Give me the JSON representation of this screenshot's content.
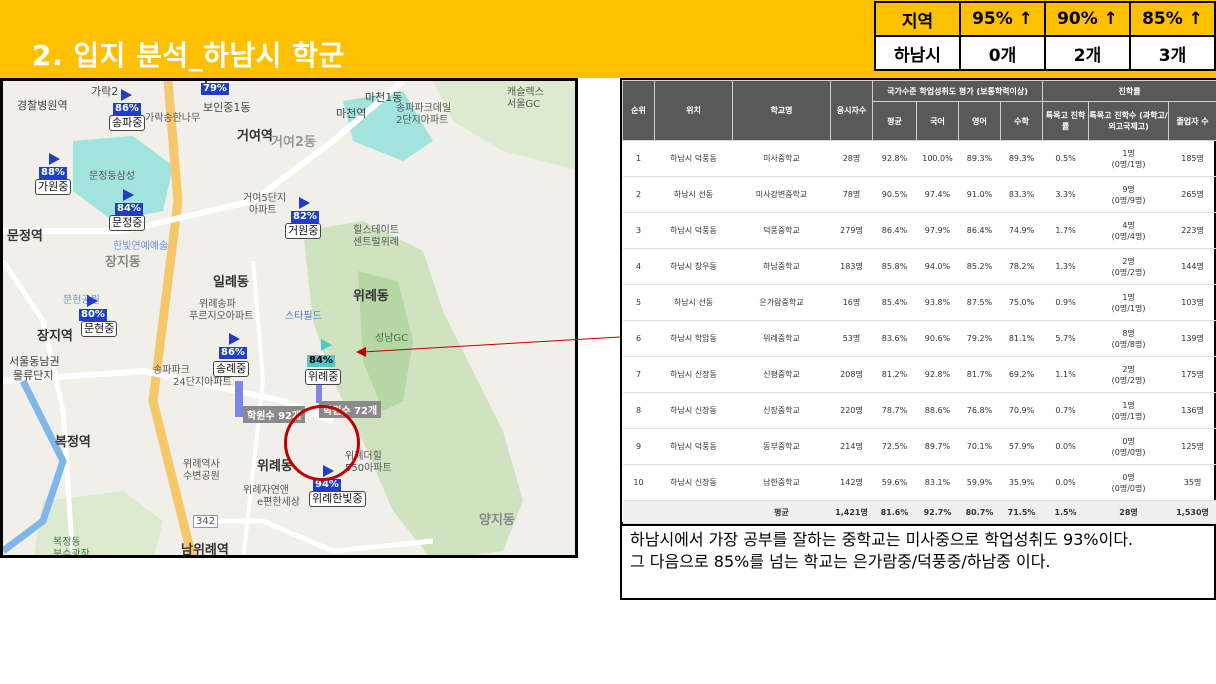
{
  "title": "2. 입지 분석_하남시 학군",
  "summary": {
    "headers": [
      "지역",
      "95% ↑",
      "90% ↑",
      "85% ↑"
    ],
    "row": [
      "하남시",
      "0개",
      "2개",
      "3개"
    ]
  },
  "map": {
    "labels": {
      "garak": "가락2",
      "gyeongchal": "경찰병원역",
      "songpa_apt": "가락송한나무",
      "boinjung": "보인중1동",
      "madang": "마천1동",
      "macheon": "마천역",
      "songpapark": "송파파크데일",
      "park2": "2단지아파트",
      "golf": "캐슬렉스",
      "seoulgc": "서울GC",
      "georyeo": "거여역",
      "georyeo2": "거여2동",
      "munjeong_saem": "문정동삼성",
      "munjeong": "문정역",
      "georyeo5": "거여5단지",
      "apt": "아파트",
      "hill": "힐스테이트",
      "central": "센트럴위례",
      "hanbit": "한빛연예예술",
      "jangji": "장지동",
      "irye": "일례동",
      "wirye_dong": "위례동",
      "wirye_songpa": "위례송파",
      "pureuji": "푸르지오아파트",
      "starfield": "스타필드",
      "seongnam": "성남GC",
      "munhyeon_park": "문현공원",
      "jangji_yeok": "장지역",
      "seouldong": "서울동남권",
      "mulryu": "물류단지",
      "songpa_24": "송파파크",
      "danji24": "24단지아파트",
      "wirye_ele": "위례역사",
      "subyeon": "수변공원",
      "wirye_dong2": "위례동",
      "wiryejayeon": "위례자연앤",
      "pyeonhan": "e편한세상",
      "wiryedel": "위례더힐",
      "apt550": "550아파트",
      "bokjeong": "복정역",
      "yangji": "양지동",
      "namwirye": "남위례역",
      "bokjeong_park": "복정동",
      "bunsugwangjang": "분수광장",
      "road342": "342"
    },
    "markers": [
      {
        "pct": "79%",
        "school": ""
      },
      {
        "pct": "86%",
        "school": "송파중"
      },
      {
        "pct": "88%",
        "school": "가원중"
      },
      {
        "pct": "84%",
        "school": "문정중"
      },
      {
        "pct": "82%",
        "school": "거원중"
      },
      {
        "pct": "80%",
        "school": "문현중"
      },
      {
        "pct": "86%",
        "school": "송례중"
      },
      {
        "pct": "84%",
        "school": "위례중"
      },
      {
        "pct": "94%",
        "school": "위례한빛중"
      }
    ],
    "tags": [
      "학원수 92개",
      "학원수 72개"
    ]
  },
  "table": {
    "group_headers": {
      "score": "국가수준 학업성취도 평가 (보통학력이상)",
      "advance": "진학률"
    },
    "headers": [
      "순위",
      "위치",
      "학교명",
      "응시자수",
      "평균",
      "국어",
      "영어",
      "수학",
      "특목고 진학률",
      "특목고 진학수 (과학고/외고국제고)",
      "졸업자 수"
    ],
    "rows": [
      [
        "1",
        "하남시 덕풍동",
        "미사중학교",
        "28명",
        "92.8%",
        "100.0%",
        "89.3%",
        "89.3%",
        "0.5%",
        "1명",
        "(0명/1명)",
        "185명"
      ],
      [
        "2",
        "하남시 선동",
        "미사강변중학교",
        "78명",
        "90.5%",
        "97.4%",
        "91.0%",
        "83.3%",
        "3.3%",
        "9명",
        "(0명/9명)",
        "265명"
      ],
      [
        "3",
        "하남시 덕풍동",
        "덕풍중학교",
        "279명",
        "86.4%",
        "97.9%",
        "86.4%",
        "74.9%",
        "1.7%",
        "4명",
        "(0명/4명)",
        "223명"
      ],
      [
        "4",
        "하남시 창우동",
        "하남중학교",
        "183명",
        "85.8%",
        "94.0%",
        "85.2%",
        "78.2%",
        "1.3%",
        "2명",
        "(0명/2명)",
        "144명"
      ],
      [
        "5",
        "하남시 선동",
        "은가람중학교",
        "16명",
        "85.4%",
        "93.8%",
        "87.5%",
        "75.0%",
        "0.9%",
        "1명",
        "(0명/1명)",
        "103명"
      ],
      [
        "6",
        "하남시 학암동",
        "위례중학교",
        "53명",
        "83.6%",
        "90.6%",
        "79.2%",
        "81.1%",
        "5.7%",
        "8명",
        "(0명/8명)",
        "139명"
      ],
      [
        "7",
        "하남시 신장동",
        "신평중학교",
        "208명",
        "81.2%",
        "92.8%",
        "81.7%",
        "69.2%",
        "1.1%",
        "2명",
        "(0명/2명)",
        "175명"
      ],
      [
        "8",
        "하남시 신장동",
        "신장중학교",
        "220명",
        "78.7%",
        "88.6%",
        "76.8%",
        "70.9%",
        "0.7%",
        "1명",
        "(0명/1명)",
        "136명"
      ],
      [
        "9",
        "하남시 덕풍동",
        "동부중학교",
        "214명",
        "72.5%",
        "89.7%",
        "70.1%",
        "57.9%",
        "0.0%",
        "0명",
        "(0명/0명)",
        "125명"
      ],
      [
        "10",
        "하남시 신장동",
        "남한중학교",
        "142명",
        "59.6%",
        "83.1%",
        "59.9%",
        "35.9%",
        "0.0%",
        "0명",
        "(0명/0명)",
        "35명"
      ]
    ],
    "avg": [
      "",
      "",
      "평균",
      "1,421명",
      "81.6%",
      "92.7%",
      "80.7%",
      "71.5%",
      "1.5%",
      "28명",
      "1,530명"
    ]
  },
  "caption": {
    "line1": "하남시에서 가장 공부를 잘하는 중학교는 미사중으로 학업성취도 93%이다.",
    "line2": "그 다음으로 85%를 넘는 학교는 은가람중/덕풍중/하남중 이다."
  },
  "colors": {
    "banner": "#FFC000",
    "marker_blue": "#1f3ec9",
    "marker_teal": "#4fc9c3",
    "table_header": "#595959",
    "highlight": "#c00000"
  }
}
